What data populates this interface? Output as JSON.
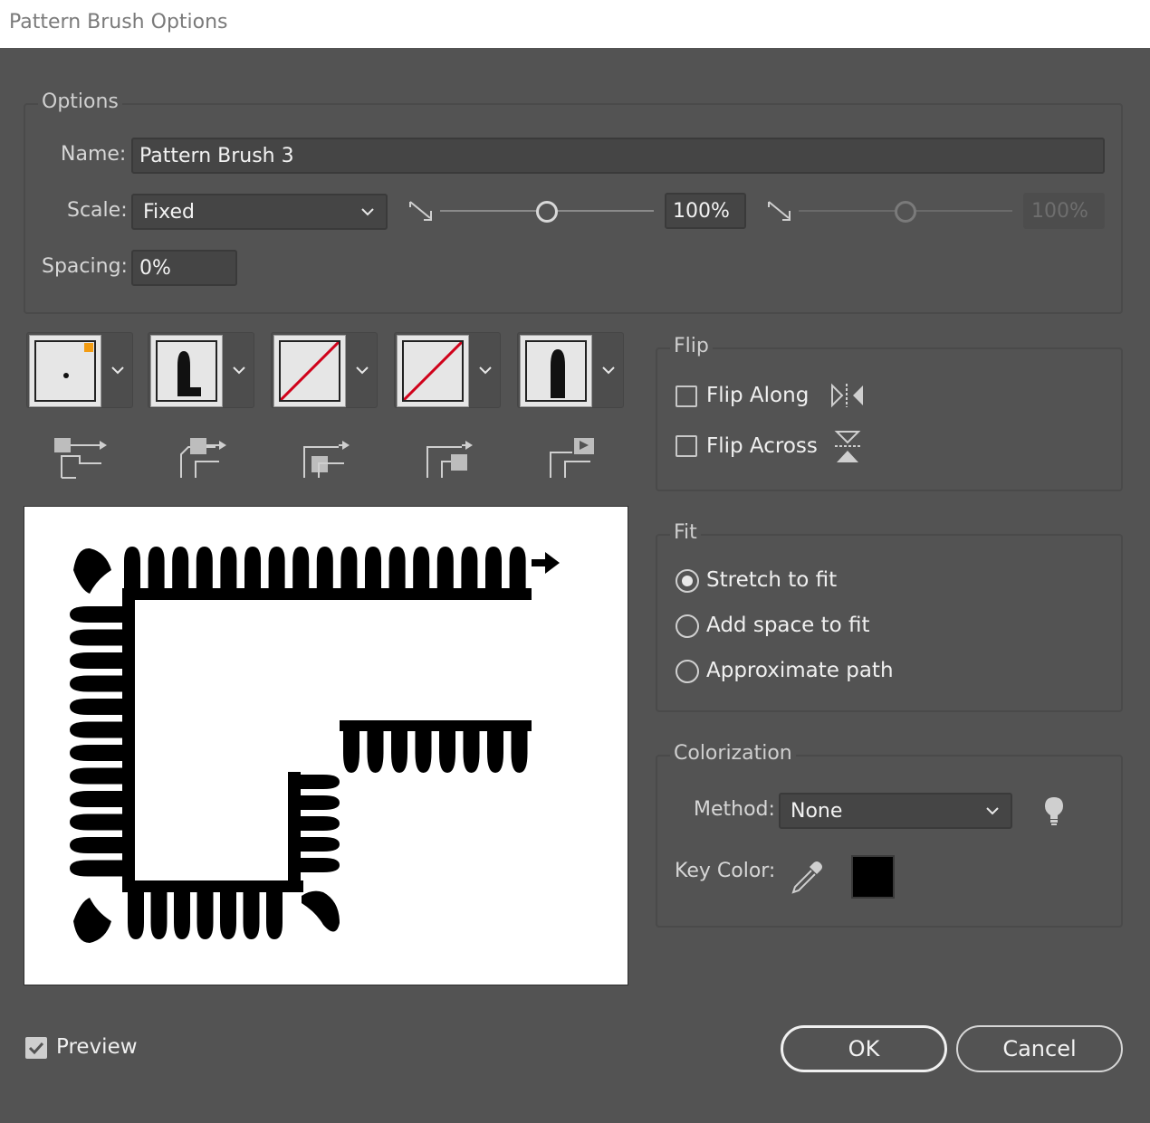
{
  "dialog": {
    "title": "Pattern Brush Options"
  },
  "options": {
    "legend": "Options",
    "name_label": "Name:",
    "name_value": "Pattern Brush 3",
    "scale_label": "Scale:",
    "scale_value": "Fixed",
    "scale_min_value": "100%",
    "scale_max_value": "100%",
    "spacing_label": "Spacing:",
    "spacing_value": "0%"
  },
  "tiles": [
    {
      "name": "side-tile",
      "kind": "dot"
    },
    {
      "name": "outer-corner-tile",
      "kind": "bullet-foot"
    },
    {
      "name": "inner-corner-tile",
      "kind": "none"
    },
    {
      "name": "start-tile",
      "kind": "none"
    },
    {
      "name": "end-tile",
      "kind": "bullet"
    }
  ],
  "flip": {
    "legend": "Flip",
    "along_label": "Flip Along",
    "across_label": "Flip Across",
    "along_checked": false,
    "across_checked": false
  },
  "fit": {
    "legend": "Fit",
    "options": [
      "Stretch to fit",
      "Add space to fit",
      "Approximate path"
    ],
    "selected": "Stretch to fit"
  },
  "colorization": {
    "legend": "Colorization",
    "method_label": "Method:",
    "method_value": "None",
    "key_color_label": "Key Color:",
    "key_color": "#000000"
  },
  "footer": {
    "preview_label": "Preview",
    "preview_checked": true,
    "ok_label": "OK",
    "cancel_label": "Cancel"
  },
  "colors": {
    "panel_bg": "#535353",
    "field_bg": "#454545",
    "accent_orange": "#f39c12",
    "none_slash": "#d0021b"
  }
}
